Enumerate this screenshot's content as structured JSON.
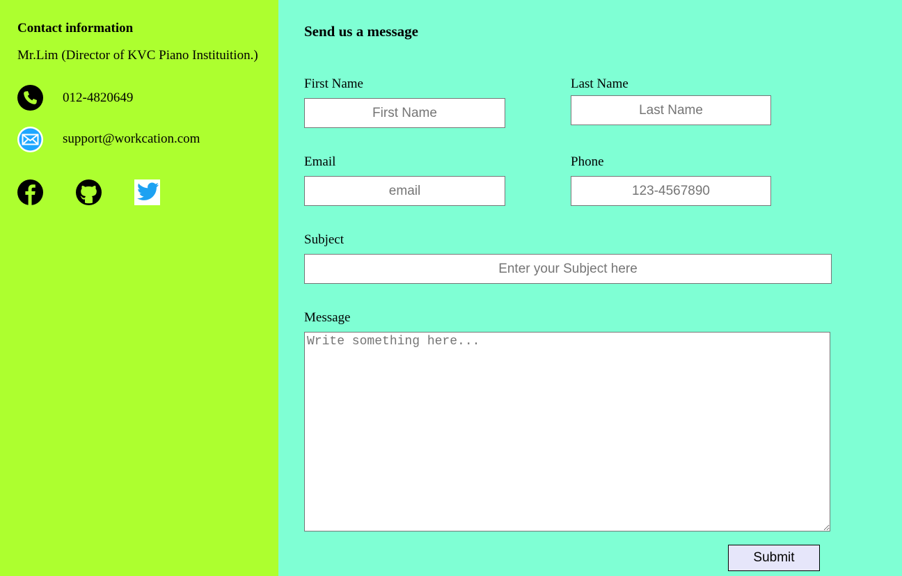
{
  "contact": {
    "title": "Contact information",
    "name": "Mr.Lim (Director of KVC Piano Instituition.)",
    "phone": "012-4820649",
    "email": "support@workcation.com"
  },
  "icons": {
    "phone": "phone-icon",
    "email": "envelope-icon",
    "facebook": "facebook-icon",
    "github": "github-icon",
    "twitter": "twitter-icon"
  },
  "colors": {
    "left_panel_bg": "#adff2f",
    "right_panel_bg": "#7fffd4",
    "email_icon_bg": "#1ea7ff",
    "twitter_blue": "#1da1f2",
    "submit_bg": "#e6e6fa"
  },
  "form": {
    "title": "Send us a message",
    "first_name": {
      "label": "First Name",
      "placeholder": "First Name",
      "value": ""
    },
    "last_name": {
      "label": "Last Name",
      "placeholder": "Last Name",
      "value": ""
    },
    "email": {
      "label": "Email",
      "placeholder": "email",
      "value": ""
    },
    "phone": {
      "label": "Phone",
      "placeholder": "123-4567890",
      "value": ""
    },
    "subject": {
      "label": "Subject",
      "placeholder": "Enter your Subject here",
      "value": ""
    },
    "message": {
      "label": "Message",
      "placeholder": "Write something here...",
      "value": ""
    },
    "submit_label": "Submit"
  }
}
